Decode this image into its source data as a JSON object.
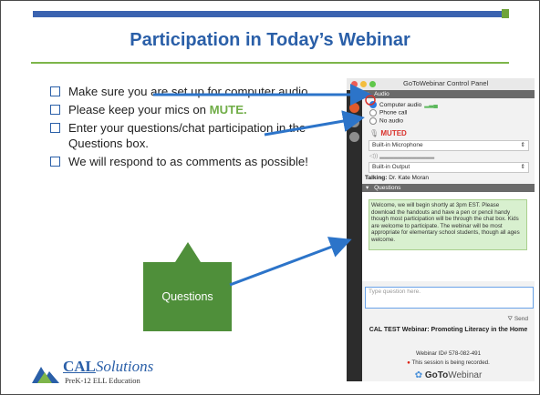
{
  "slide": {
    "title": "Participation in Today’s Webinar",
    "bullets": [
      {
        "pre": "Make sure you are set up for computer audio.",
        "highlight": "",
        "post": ""
      },
      {
        "pre": "Please keep your mics on ",
        "highlight": "MUTE",
        "post": "."
      },
      {
        "pre": "Enter your questions/chat participation in the Questions box.",
        "highlight": "",
        "post": ""
      },
      {
        "pre": "We will respond to as comments as possible!",
        "highlight": "",
        "post": ""
      }
    ],
    "callout": "Questions",
    "logo": {
      "bold": "CAL",
      "italic": "Solutions",
      "sub": "PreK-12 ELL Education"
    }
  },
  "panel": {
    "window_title": "GoToWebinar Control Panel",
    "audio_section": "Audio",
    "audio_options": [
      "Computer audio",
      "Phone call",
      "No audio"
    ],
    "selected_option": "Computer audio",
    "muted_label": "MUTED",
    "microphone": "Built-in Microphone",
    "output": "Built-in Output",
    "talking_label": "Talking:",
    "talking_name": "Dr. Kate Moran",
    "questions_section": "Questions",
    "chat_message": "Welcome, we will begin shortly at 3pm EST. Please download the handouts and have a pen or pencil handy though most participation will be through the chat box. Kids are welcome to participate. The webinar will be most appropriate for elementary school students, though all ages welcome.",
    "question_placeholder": "Type question here.",
    "send_label": "Send",
    "webinar_title": "CAL TEST Webinar: Promoting Literacy in the Home",
    "webinar_id": "Webinar ID# 578-082-491",
    "recording_notice": "This session is being recorded.",
    "brand_bold": "GoTo",
    "brand_rest": "Webinar"
  },
  "colors": {
    "title_blue": "#2a5fa8",
    "accent_green": "#70ad47",
    "callout_green": "#4f8f3a",
    "arrow_blue": "#2c74c9",
    "muted_red": "#d9312b"
  }
}
